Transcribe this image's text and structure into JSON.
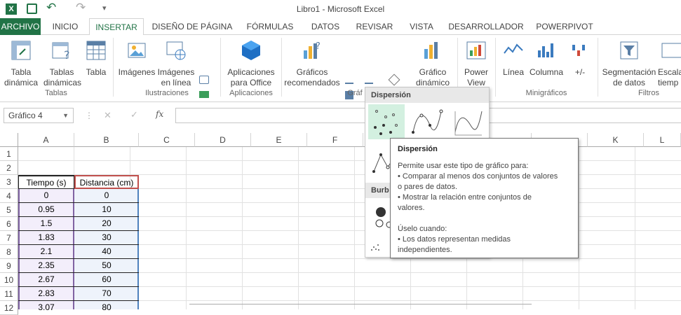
{
  "window": {
    "title": "Libro1 - Microsoft Excel"
  },
  "qat": {
    "undo": "↶",
    "redo": "↷",
    "more": "▾"
  },
  "tabs": [
    {
      "label": "ARCHIVO"
    },
    {
      "label": "INICIO"
    },
    {
      "label": "INSERTAR"
    },
    {
      "label": "DISEÑO DE PÁGINA"
    },
    {
      "label": "FÓRMULAS"
    },
    {
      "label": "DATOS"
    },
    {
      "label": "REVISAR"
    },
    {
      "label": "VISTA"
    },
    {
      "label": "DESARROLLADOR"
    },
    {
      "label": "POWERPIVOT"
    }
  ],
  "ribbon": {
    "btn_tabla_dinamica_1": "Tabla",
    "btn_tabla_dinamica_2": "dinámica",
    "btn_tablas_din_1": "Tablas",
    "btn_tablas_din_2": "dinámicas",
    "btn_tabla": "Tabla",
    "btn_imagenes": "Imágenes",
    "btn_img_linea_1": "Imágenes",
    "btn_img_linea_2": "en línea",
    "btn_apps_1": "Aplicaciones",
    "btn_apps_2": "para Office",
    "btn_graf_rec_1": "Gráficos",
    "btn_graf_rec_2": "recomendados",
    "btn_graf_din_1": "Gráfico",
    "btn_graf_din_2": "dinámico",
    "btn_power_1": "Power",
    "btn_power_2": "View",
    "btn_linea": "Línea",
    "btn_columna": "Columna",
    "btn_plusminus": "+/-",
    "btn_segm_1": "Segmentación",
    "btn_segm_2": "de datos",
    "btn_escala_1": "Escala",
    "btn_escala_2": "tiemp",
    "grp_tablas": "Tablas",
    "grp_ilustraciones": "Ilustraciones",
    "grp_aplicaciones": "Aplicaciones",
    "grp_graficos": "Gráf",
    "grp_minigraficos": "Minigráficos",
    "grp_filtros": "Filtros"
  },
  "formula_bar": {
    "namebox": "Gráfico 4",
    "fx": "fx",
    "cancel": "✕",
    "enter": "✓"
  },
  "columns": [
    "A",
    "B",
    "C",
    "D",
    "E",
    "F",
    "K",
    "L"
  ],
  "rows": [
    "1",
    "2",
    "3",
    "4",
    "5",
    "6",
    "7",
    "8",
    "9",
    "10",
    "11",
    "12"
  ],
  "table": {
    "header_a": "Tiempo (s)",
    "header_b": "Distancia (cm)",
    "tiempo": [
      "0",
      "0.95",
      "1.5",
      "1.83",
      "2.1",
      "2.35",
      "2.67",
      "2.83",
      "3.07"
    ],
    "distancia": [
      "0",
      "10",
      "20",
      "30",
      "40",
      "50",
      "60",
      "70",
      "80"
    ]
  },
  "dropdown": {
    "section1": "Dispersión",
    "section2": "Burb"
  },
  "tooltip": {
    "title": "Dispersión",
    "line1": "Permite usar este tipo de gráfico para:",
    "line2": "• Comparar al menos dos conjuntos de valores",
    "line3": "o pares de datos.",
    "line4": "• Mostrar la relación entre conjuntos de",
    "line5": "valores.",
    "line6": "Úselo cuando:",
    "line7": "• Los datos representan medidas",
    "line8": "independientes."
  },
  "colors": {
    "accent": "#217346",
    "selection_green": "#d3f0e0"
  }
}
